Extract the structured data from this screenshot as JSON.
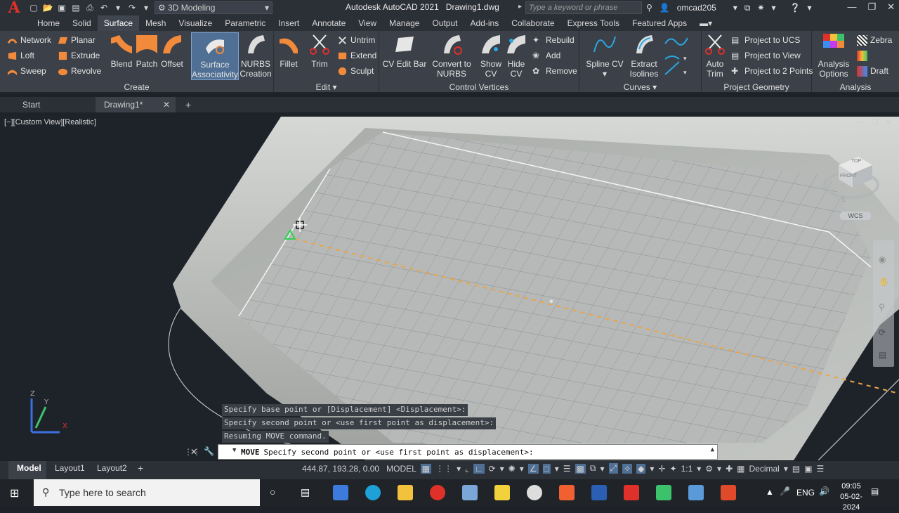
{
  "app": {
    "title": "Autodesk AutoCAD 2021",
    "document": "Drawing1.dwg",
    "workspace": "3D Modeling",
    "search_placeholder": "Type a keyword or phrase",
    "user": "omcad205"
  },
  "menu_tabs": [
    "Home",
    "Solid",
    "Surface",
    "Mesh",
    "Visualize",
    "Parametric",
    "Insert",
    "Annotate",
    "View",
    "Manage",
    "Output",
    "Add-ins",
    "Collaborate",
    "Express Tools",
    "Featured Apps"
  ],
  "active_tab": "Surface",
  "ribbon": {
    "create": {
      "title": "Create",
      "network": "Network",
      "loft": "Loft",
      "sweep": "Sweep",
      "planar": "Planar",
      "extrude": "Extrude",
      "revolve": "Revolve",
      "blend": "Blend",
      "patch": "Patch",
      "offset": "Offset",
      "surface_assoc_1": "Surface",
      "surface_assoc_2": "Associativity",
      "nurbs_1": "NURBS",
      "nurbs_2": "Creation"
    },
    "edit": {
      "title": "Edit",
      "fillet": "Fillet",
      "trim": "Trim",
      "untrim": "Untrim",
      "extend": "Extend",
      "sculpt": "Sculpt"
    },
    "cv": {
      "title": "Control Vertices",
      "cv_edit_bar": "CV Edit Bar",
      "convert_1": "Convert to",
      "convert_2": "NURBS",
      "show_1": "Show",
      "show_2": "CV",
      "hide_1": "Hide",
      "hide_2": "CV",
      "rebuild": "Rebuild",
      "add": "Add",
      "remove": "Remove"
    },
    "curves": {
      "title": "Curves",
      "spline_cv": "Spline CV",
      "extract_1": "Extract",
      "extract_2": "Isolines"
    },
    "project": {
      "title": "Project Geometry",
      "auto_1": "Auto",
      "auto_2": "Trim",
      "to_ucs": "Project to UCS",
      "to_view": "Project to View",
      "to_points": "Project to 2 Points"
    },
    "analysis": {
      "title": "Analysis",
      "options_1": "Analysis",
      "options_2": "Options",
      "zebra": "Zebra",
      "draft": "Draft"
    }
  },
  "file_tabs": [
    "Start",
    "Drawing1*"
  ],
  "viewport": {
    "label": "[−][Custom View][Realistic]",
    "viewcube_top": "TOP",
    "viewcube_front": "FRONT",
    "wcs": "WCS"
  },
  "command": {
    "history": [
      "Specify base point or [Displacement] <Displacement>:",
      "Specify second point or <use first point as displacement>:",
      "Resuming MOVE command."
    ],
    "cmd": "MOVE",
    "prompt": "Specify second point or <use first point as displacement>:"
  },
  "status": {
    "layouts": [
      "Model",
      "Layout1",
      "Layout2"
    ],
    "coords": "444.87, 193.28, 0.00",
    "space": "MODEL",
    "scale": "1:1",
    "units": "Decimal"
  },
  "taskbar": {
    "search_placeholder": "Type here to search",
    "lang": "ENG",
    "time": "09:05",
    "date": "05-02-2024"
  },
  "colors": {
    "accent": "#4f6f94",
    "autocad_red": "#e0302a",
    "viewport_bg": "#1e232a"
  }
}
